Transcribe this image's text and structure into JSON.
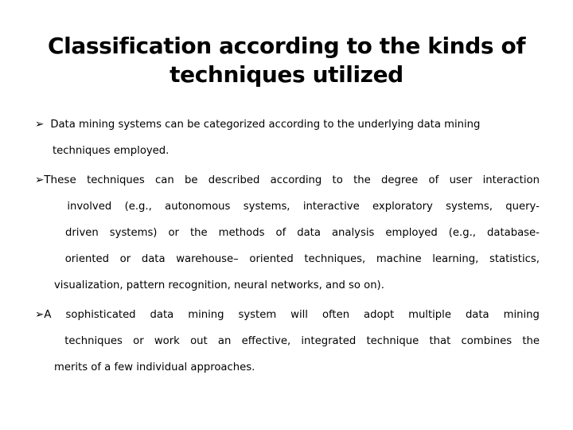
{
  "slide": {
    "background_color": "#ffffff",
    "text_color": "#000000",
    "title": {
      "line1": "Classification according to the kinds of",
      "line2": "techniques utilized"
    },
    "bullet_marker": "➢",
    "bullets": [
      {
        "id": "bullet-1",
        "alignment": "left",
        "lines": [
          {
            "has_marker": true,
            "text": "Data mining systems can be categorized according to the underlying data mining"
          },
          {
            "has_marker": false,
            "text": "techniques employed."
          }
        ]
      },
      {
        "id": "bullet-2",
        "alignment": "justify",
        "lines": [
          {
            "has_marker": true,
            "words": [
              "These",
              "techniques",
              "can",
              "be",
              "described",
              "according",
              "to",
              "the",
              "degree",
              "of",
              "user",
              "interaction"
            ]
          },
          {
            "has_marker": false,
            "words": [
              "involved",
              "(e.g.,",
              "autonomous",
              "systems,",
              "interactive",
              "exploratory",
              "systems,",
              "query-"
            ]
          },
          {
            "has_marker": false,
            "words": [
              "driven",
              "systems)",
              "or",
              "the",
              "methods",
              "of",
              "data",
              "analysis",
              "employed",
              "(e.g.,",
              "database-"
            ]
          },
          {
            "has_marker": false,
            "words": [
              "oriented",
              "or",
              "data",
              "warehouse–",
              "oriented",
              "techniques,",
              "machine",
              "learning,",
              "statistics,"
            ]
          },
          {
            "has_marker": false,
            "words": [
              "visualization,",
              "pattern",
              "recognition,",
              "neural",
              "networks,",
              "and",
              "so",
              "on)."
            ]
          }
        ]
      },
      {
        "id": "bullet-3",
        "alignment": "justify",
        "lines": [
          {
            "has_marker": true,
            "words": [
              "A",
              "sophisticated",
              "data",
              "mining",
              "system",
              "will",
              "often",
              "adopt",
              "multiple",
              "data",
              "mining"
            ]
          },
          {
            "has_marker": false,
            "words": [
              "techniques",
              "or",
              "work",
              "out",
              "an",
              "effective,",
              "integrated",
              "technique",
              "that",
              "combines",
              "the"
            ]
          },
          {
            "has_marker": false,
            "words": [
              "merits",
              "of",
              "a",
              "few",
              "individual",
              "approaches."
            ]
          }
        ]
      }
    ]
  }
}
